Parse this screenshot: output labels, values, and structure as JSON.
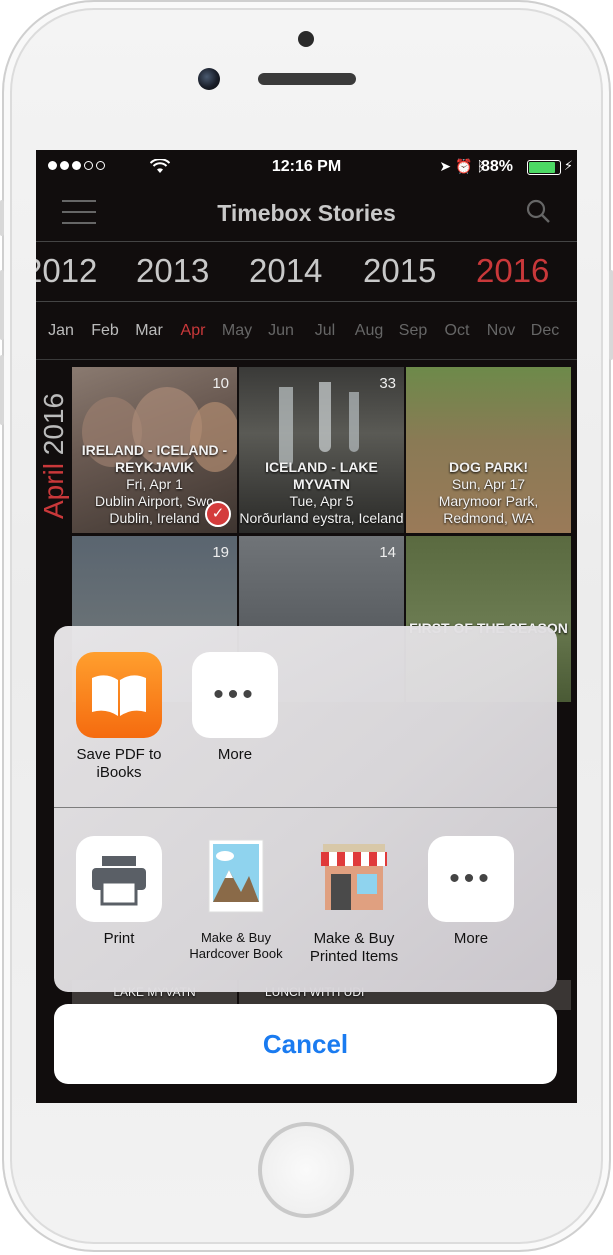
{
  "status": {
    "time": "12:16 PM",
    "battery_pct": "88%"
  },
  "nav": {
    "title": "Timebox Stories"
  },
  "years": [
    "2012",
    "2013",
    "2014",
    "2015",
    "2016"
  ],
  "months": [
    "Jan",
    "Feb",
    "Mar",
    "Apr",
    "May",
    "Jun",
    "Jul",
    "Aug",
    "Sep",
    "Oct",
    "Nov",
    "Dec"
  ],
  "side_label": {
    "month": "April",
    "year": "2016"
  },
  "tiles": [
    {
      "count": "10",
      "title": "IRELAND - ICELAND - REYKJAVIK",
      "date": "Fri, Apr 1",
      "place": "Dublin Airport, Swo Dublin, Ireland"
    },
    {
      "count": "33",
      "title": "ICELAND - LAKE MYVATN",
      "date": "Tue, Apr 5",
      "place": "Norðurland eystra, Iceland"
    },
    {
      "count": "",
      "title": "DOG PARK!",
      "date": "Sun, Apr 17",
      "place": "Marymoor Park, Redmond, WA"
    },
    {
      "count": "19",
      "title": "",
      "date": "",
      "place": ""
    },
    {
      "count": "14",
      "title": "",
      "date": "",
      "place": ""
    },
    {
      "count": "",
      "title": "FIRST OF THE SEASON",
      "date": "",
      "place": ""
    }
  ],
  "bottom_tiles": {
    "left": "LAKE MYVATN",
    "right": "LUNCH WITH UDI"
  },
  "share": {
    "row1": [
      {
        "label": "Save PDF to iBooks",
        "icon": "ibooks-icon"
      },
      {
        "label": "More",
        "icon": "more-icon"
      }
    ],
    "row2": [
      {
        "label": "Print",
        "icon": "print-icon"
      },
      {
        "label": "Make & Buy Hardcover Book",
        "icon": "photo-book-icon"
      },
      {
        "label": "Make & Buy Printed Items",
        "icon": "storefront-icon"
      },
      {
        "label": "More",
        "icon": "more-icon"
      }
    ],
    "cancel": "Cancel"
  },
  "colors": {
    "accent_red": "#c9383a",
    "ios_blue": "#1a7bf0",
    "battery_green": "#4cd964"
  }
}
